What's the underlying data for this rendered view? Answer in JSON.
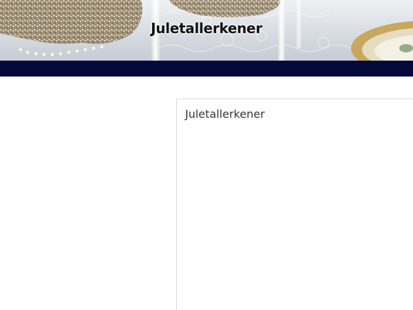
{
  "header": {
    "site_title": "Juletallerkener"
  },
  "main": {
    "card_title": "Juletallerkener"
  },
  "colors": {
    "nav_bar": "#050a3a",
    "title_text": "#111111",
    "card_border": "#dcdcdc",
    "page_background": "#ffffff"
  }
}
